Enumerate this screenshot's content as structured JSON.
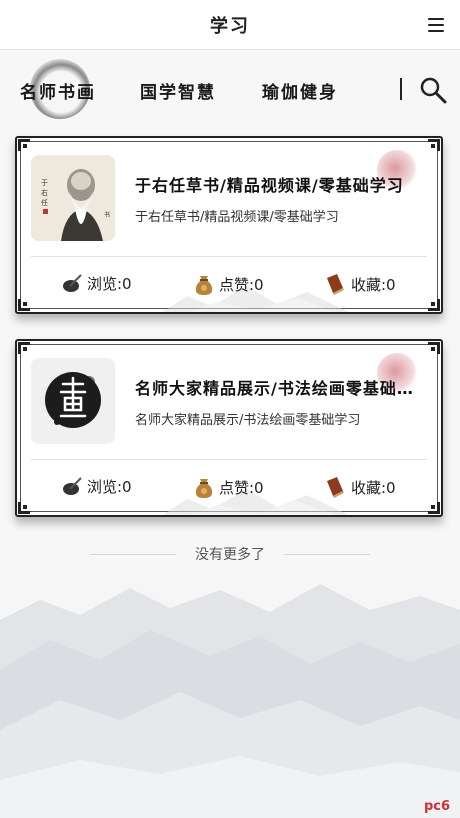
{
  "header": {
    "title": "学习",
    "menu_icon": "menu-icon"
  },
  "tabs": [
    {
      "label": "名师书画",
      "active": true
    },
    {
      "label": "国学智慧",
      "active": false
    },
    {
      "label": "瑜伽健身",
      "active": false
    }
  ],
  "search_icon": "search-icon",
  "cards": [
    {
      "title": "于右任草书/精品视频课/零基础学习",
      "description": "于右任草书/精品视频课/零基础学习",
      "stats": {
        "view": "浏览:0",
        "like": "点赞:0",
        "fav": "收藏:0"
      }
    },
    {
      "title": "名师大家精品展示/书法绘画零基础学习",
      "description": "名师大家精品展示/书法绘画零基础学习",
      "stats": {
        "view": "浏览:0",
        "like": "点赞:0",
        "fav": "收藏:0"
      }
    }
  ],
  "no_more": "没有更多了",
  "watermark": {
    "prefix": "pc",
    "suffix": "6"
  },
  "colors": {
    "accent_seal": "#c0505e",
    "ink": "#222222"
  }
}
